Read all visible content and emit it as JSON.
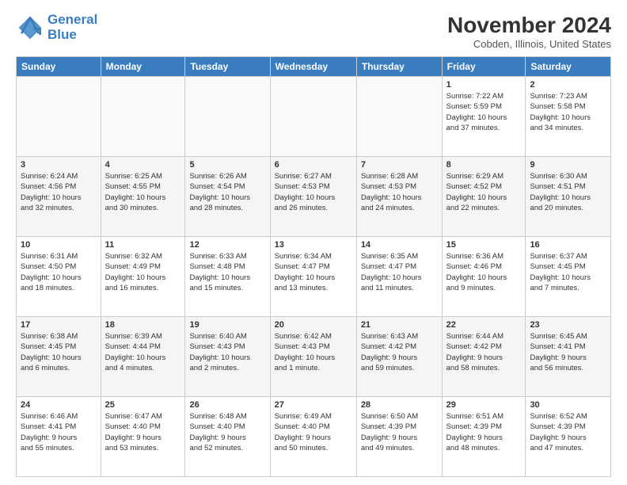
{
  "header": {
    "logo_line1": "General",
    "logo_line2": "Blue",
    "title": "November 2024",
    "subtitle": "Cobden, Illinois, United States"
  },
  "days_of_week": [
    "Sunday",
    "Monday",
    "Tuesday",
    "Wednesday",
    "Thursday",
    "Friday",
    "Saturday"
  ],
  "weeks": [
    [
      {
        "day": "",
        "detail": ""
      },
      {
        "day": "",
        "detail": ""
      },
      {
        "day": "",
        "detail": ""
      },
      {
        "day": "",
        "detail": ""
      },
      {
        "day": "",
        "detail": ""
      },
      {
        "day": "1",
        "detail": "Sunrise: 7:22 AM\nSunset: 5:59 PM\nDaylight: 10 hours\nand 37 minutes."
      },
      {
        "day": "2",
        "detail": "Sunrise: 7:23 AM\nSunset: 5:58 PM\nDaylight: 10 hours\nand 34 minutes."
      }
    ],
    [
      {
        "day": "3",
        "detail": "Sunrise: 6:24 AM\nSunset: 4:56 PM\nDaylight: 10 hours\nand 32 minutes."
      },
      {
        "day": "4",
        "detail": "Sunrise: 6:25 AM\nSunset: 4:55 PM\nDaylight: 10 hours\nand 30 minutes."
      },
      {
        "day": "5",
        "detail": "Sunrise: 6:26 AM\nSunset: 4:54 PM\nDaylight: 10 hours\nand 28 minutes."
      },
      {
        "day": "6",
        "detail": "Sunrise: 6:27 AM\nSunset: 4:53 PM\nDaylight: 10 hours\nand 26 minutes."
      },
      {
        "day": "7",
        "detail": "Sunrise: 6:28 AM\nSunset: 4:53 PM\nDaylight: 10 hours\nand 24 minutes."
      },
      {
        "day": "8",
        "detail": "Sunrise: 6:29 AM\nSunset: 4:52 PM\nDaylight: 10 hours\nand 22 minutes."
      },
      {
        "day": "9",
        "detail": "Sunrise: 6:30 AM\nSunset: 4:51 PM\nDaylight: 10 hours\nand 20 minutes."
      }
    ],
    [
      {
        "day": "10",
        "detail": "Sunrise: 6:31 AM\nSunset: 4:50 PM\nDaylight: 10 hours\nand 18 minutes."
      },
      {
        "day": "11",
        "detail": "Sunrise: 6:32 AM\nSunset: 4:49 PM\nDaylight: 10 hours\nand 16 minutes."
      },
      {
        "day": "12",
        "detail": "Sunrise: 6:33 AM\nSunset: 4:48 PM\nDaylight: 10 hours\nand 15 minutes."
      },
      {
        "day": "13",
        "detail": "Sunrise: 6:34 AM\nSunset: 4:47 PM\nDaylight: 10 hours\nand 13 minutes."
      },
      {
        "day": "14",
        "detail": "Sunrise: 6:35 AM\nSunset: 4:47 PM\nDaylight: 10 hours\nand 11 minutes."
      },
      {
        "day": "15",
        "detail": "Sunrise: 6:36 AM\nSunset: 4:46 PM\nDaylight: 10 hours\nand 9 minutes."
      },
      {
        "day": "16",
        "detail": "Sunrise: 6:37 AM\nSunset: 4:45 PM\nDaylight: 10 hours\nand 7 minutes."
      }
    ],
    [
      {
        "day": "17",
        "detail": "Sunrise: 6:38 AM\nSunset: 4:45 PM\nDaylight: 10 hours\nand 6 minutes."
      },
      {
        "day": "18",
        "detail": "Sunrise: 6:39 AM\nSunset: 4:44 PM\nDaylight: 10 hours\nand 4 minutes."
      },
      {
        "day": "19",
        "detail": "Sunrise: 6:40 AM\nSunset: 4:43 PM\nDaylight: 10 hours\nand 2 minutes."
      },
      {
        "day": "20",
        "detail": "Sunrise: 6:42 AM\nSunset: 4:43 PM\nDaylight: 10 hours\nand 1 minute."
      },
      {
        "day": "21",
        "detail": "Sunrise: 6:43 AM\nSunset: 4:42 PM\nDaylight: 9 hours\nand 59 minutes."
      },
      {
        "day": "22",
        "detail": "Sunrise: 6:44 AM\nSunset: 4:42 PM\nDaylight: 9 hours\nand 58 minutes."
      },
      {
        "day": "23",
        "detail": "Sunrise: 6:45 AM\nSunset: 4:41 PM\nDaylight: 9 hours\nand 56 minutes."
      }
    ],
    [
      {
        "day": "24",
        "detail": "Sunrise: 6:46 AM\nSunset: 4:41 PM\nDaylight: 9 hours\nand 55 minutes."
      },
      {
        "day": "25",
        "detail": "Sunrise: 6:47 AM\nSunset: 4:40 PM\nDaylight: 9 hours\nand 53 minutes."
      },
      {
        "day": "26",
        "detail": "Sunrise: 6:48 AM\nSunset: 4:40 PM\nDaylight: 9 hours\nand 52 minutes."
      },
      {
        "day": "27",
        "detail": "Sunrise: 6:49 AM\nSunset: 4:40 PM\nDaylight: 9 hours\nand 50 minutes."
      },
      {
        "day": "28",
        "detail": "Sunrise: 6:50 AM\nSunset: 4:39 PM\nDaylight: 9 hours\nand 49 minutes."
      },
      {
        "day": "29",
        "detail": "Sunrise: 6:51 AM\nSunset: 4:39 PM\nDaylight: 9 hours\nand 48 minutes."
      },
      {
        "day": "30",
        "detail": "Sunrise: 6:52 AM\nSunset: 4:39 PM\nDaylight: 9 hours\nand 47 minutes."
      }
    ]
  ]
}
